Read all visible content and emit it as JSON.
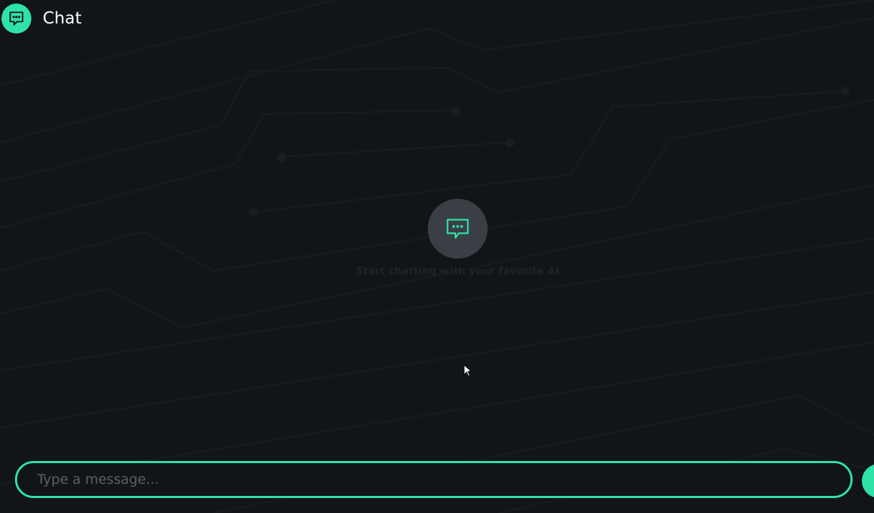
{
  "header": {
    "title": "Chat",
    "logo_icon": "chat-bubble-icon"
  },
  "empty_state": {
    "icon": "chat-bubble-icon",
    "text": "Start chatting with your favorite AI"
  },
  "composer": {
    "placeholder": "Type a message...",
    "value": "",
    "send_icon": "send-icon"
  },
  "colors": {
    "accent": "#2fe3a8",
    "background": "#121518",
    "empty_icon_bg": "#3a3f45"
  }
}
